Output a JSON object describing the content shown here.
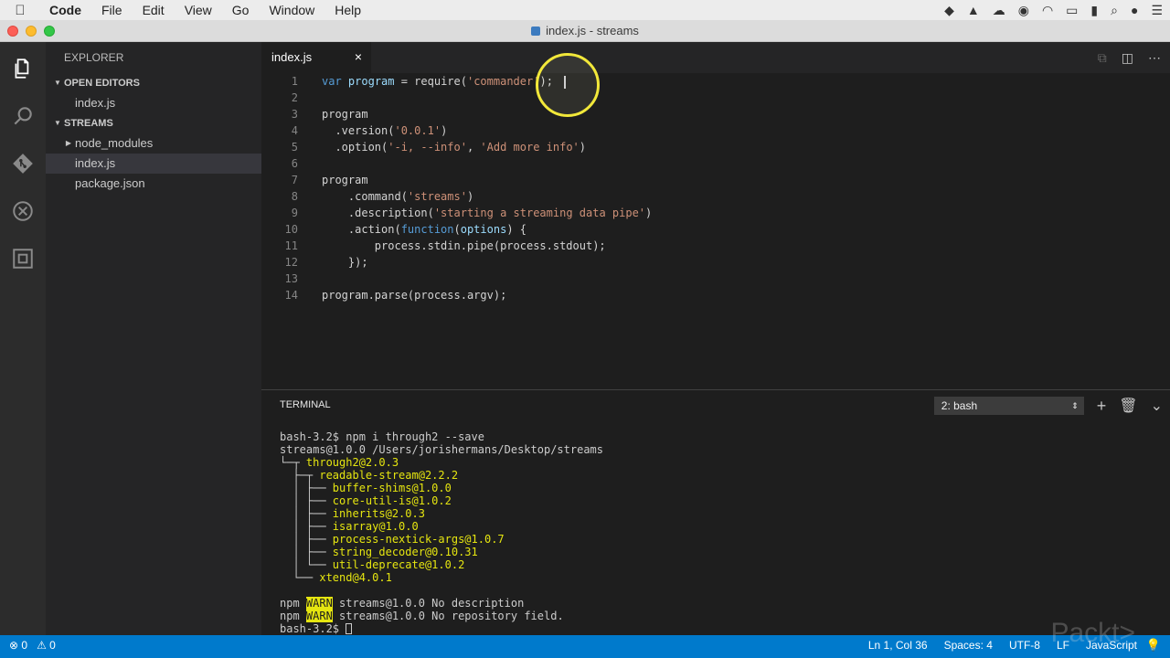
{
  "menubar": {
    "app": "Code",
    "items": [
      "File",
      "Edit",
      "View",
      "Go",
      "Window",
      "Help"
    ]
  },
  "window": {
    "title": "index.js - streams"
  },
  "sidebar": {
    "header": "EXPLORER",
    "open_editors_title": "OPEN EDITORS",
    "open_editors": [
      "index.js"
    ],
    "folder_title": "STREAMS",
    "files": [
      "node_modules",
      "index.js",
      "package.json"
    ]
  },
  "editor": {
    "tab_label": "index.js",
    "tab_close": "×",
    "lines": [
      {
        "n": "1",
        "parts": [
          [
            "kw",
            "var"
          ],
          [
            "t",
            " "
          ],
          [
            "var",
            "program"
          ],
          [
            "t",
            " = require("
          ],
          [
            "str",
            "'commander'"
          ],
          [
            "t",
            ");"
          ]
        ]
      },
      {
        "n": "2",
        "parts": []
      },
      {
        "n": "3",
        "parts": [
          [
            "t",
            "program"
          ]
        ]
      },
      {
        "n": "4",
        "parts": [
          [
            "t",
            "  .version("
          ],
          [
            "str",
            "'0.0.1'"
          ],
          [
            "t",
            ")"
          ]
        ]
      },
      {
        "n": "5",
        "parts": [
          [
            "t",
            "  .option("
          ],
          [
            "str",
            "'-i, --info'"
          ],
          [
            "t",
            ", "
          ],
          [
            "str",
            "'Add more info'"
          ],
          [
            "t",
            ")"
          ]
        ]
      },
      {
        "n": "6",
        "parts": []
      },
      {
        "n": "7",
        "parts": [
          [
            "t",
            "program"
          ]
        ]
      },
      {
        "n": "8",
        "parts": [
          [
            "t",
            "    .command("
          ],
          [
            "str",
            "'streams'"
          ],
          [
            "t",
            ")"
          ]
        ]
      },
      {
        "n": "9",
        "parts": [
          [
            "t",
            "    .description("
          ],
          [
            "str",
            "'starting a streaming data pipe'"
          ],
          [
            "t",
            ")"
          ]
        ]
      },
      {
        "n": "10",
        "parts": [
          [
            "t",
            "    .action("
          ],
          [
            "kw",
            "function"
          ],
          [
            "t",
            "("
          ],
          [
            "var",
            "options"
          ],
          [
            "t",
            ") {"
          ]
        ]
      },
      {
        "n": "11",
        "parts": [
          [
            "t",
            "        process.stdin.pipe(process.stdout);"
          ]
        ]
      },
      {
        "n": "12",
        "parts": [
          [
            "t",
            "    });"
          ]
        ]
      },
      {
        "n": "13",
        "parts": []
      },
      {
        "n": "14",
        "parts": [
          [
            "t",
            "program.parse(process.argv);"
          ]
        ]
      }
    ]
  },
  "panel": {
    "title": "TERMINAL",
    "selector_value": "2: bash",
    "lines": [
      [
        [
          "t",
          "bash-3.2$ npm i through2 --save"
        ]
      ],
      [
        [
          "t",
          "streams@1.0.0 /Users/jorishermans/Desktop/streams"
        ]
      ],
      [
        [
          "tree",
          "└─┬ "
        ],
        [
          "yel",
          "through2@2.0.3"
        ]
      ],
      [
        [
          "tree",
          "  ├─┬ "
        ],
        [
          "yel",
          "readable-stream@2.2.2"
        ]
      ],
      [
        [
          "tree",
          "  │ ├── "
        ],
        [
          "yel",
          "buffer-shims@1.0.0"
        ]
      ],
      [
        [
          "tree",
          "  │ ├── "
        ],
        [
          "yel",
          "core-util-is@1.0.2"
        ]
      ],
      [
        [
          "tree",
          "  │ ├── "
        ],
        [
          "yel",
          "inherits@2.0.3"
        ]
      ],
      [
        [
          "tree",
          "  │ ├── "
        ],
        [
          "yel",
          "isarray@1.0.0"
        ]
      ],
      [
        [
          "tree",
          "  │ ├── "
        ],
        [
          "yel",
          "process-nextick-args@1.0.7"
        ]
      ],
      [
        [
          "tree",
          "  │ ├── "
        ],
        [
          "yel",
          "string_decoder@0.10.31"
        ]
      ],
      [
        [
          "tree",
          "  │ └── "
        ],
        [
          "yel",
          "util-deprecate@1.0.2"
        ]
      ],
      [
        [
          "tree",
          "  └── "
        ],
        [
          "yel",
          "xtend@4.0.1"
        ]
      ],
      [
        [
          "t",
          ""
        ]
      ],
      [
        [
          "t",
          "npm "
        ],
        [
          "warn",
          "WARN"
        ],
        [
          "t",
          " streams@1.0.0 No description"
        ]
      ],
      [
        [
          "t",
          "npm "
        ],
        [
          "warn",
          "WARN"
        ],
        [
          "t",
          " streams@1.0.0 No repository field."
        ]
      ],
      [
        [
          "t",
          "bash-3.2$ "
        ],
        [
          "cursor",
          ""
        ]
      ]
    ]
  },
  "statusbar": {
    "errors": "⊗ 0",
    "warnings": "⚠ 0",
    "position": "Ln 1, Col 36",
    "spaces": "Spaces: 4",
    "encoding": "UTF-8",
    "eol": "LF",
    "language": "JavaScript"
  },
  "watermark": "Packt>"
}
